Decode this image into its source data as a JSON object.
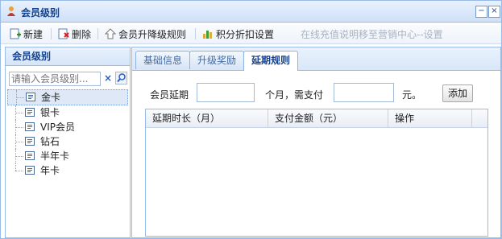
{
  "window": {
    "title": "会员级别",
    "minimize_symbol": "−",
    "close_symbol": "×"
  },
  "toolbar": {
    "new_label": "新建",
    "delete_label": "删除",
    "upgrade_rules_label": "会员升降级规则",
    "points_discount_label": "积分折扣设置",
    "notice_label": "在线充值说明移至营销中心--设置"
  },
  "left_panel": {
    "title": "会员级别",
    "search_placeholder": "请输入会员级别...",
    "clear_symbol": "×",
    "items": [
      {
        "label": "金卡",
        "selected": true
      },
      {
        "label": "银卡",
        "selected": false
      },
      {
        "label": "VIP会员",
        "selected": false
      },
      {
        "label": "钻石",
        "selected": false
      },
      {
        "label": "半年卡",
        "selected": false
      },
      {
        "label": "年卡",
        "selected": false
      }
    ]
  },
  "tabs": [
    {
      "label": "基础信息",
      "active": false
    },
    {
      "label": "升级奖励",
      "active": false
    },
    {
      "label": "延期规则",
      "active": true
    }
  ],
  "form": {
    "extend_label": "会员延期",
    "month_value": "",
    "month_suffix": "个月，需支付",
    "pay_value": "",
    "currency_suffix": "元。",
    "add_label": "添加"
  },
  "grid": {
    "columns": [
      "延期时长（月）",
      "支付金额（元）",
      "操作"
    ],
    "rows": []
  },
  "colors": {
    "border": "#99bbe8",
    "header_text": "#15428b",
    "selected_row": "#dfe8f6"
  }
}
